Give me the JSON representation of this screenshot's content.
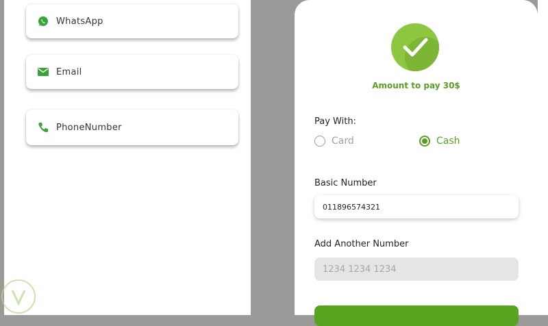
{
  "contacts": {
    "items": [
      {
        "label": "WhatsApp",
        "icon": "whatsapp-icon"
      },
      {
        "label": "Email",
        "icon": "email-icon"
      },
      {
        "label": "PhoneNumber",
        "icon": "phone-icon"
      }
    ]
  },
  "payment": {
    "amount_text": "Amount to pay 30$",
    "pay_with_label": "Pay With:",
    "options": [
      {
        "label": "Card",
        "selected": false
      },
      {
        "label": "Cash",
        "selected": true
      }
    ],
    "basic_number_label": "Basic Number",
    "basic_number_value": "011896574321",
    "another_number_label": "Add Another Number",
    "another_number_placeholder": "1234 1234 1234"
  },
  "colors": {
    "accent_green": "#5a9e22",
    "check_green": "#8dc63f",
    "button_green": "#5aa320"
  }
}
